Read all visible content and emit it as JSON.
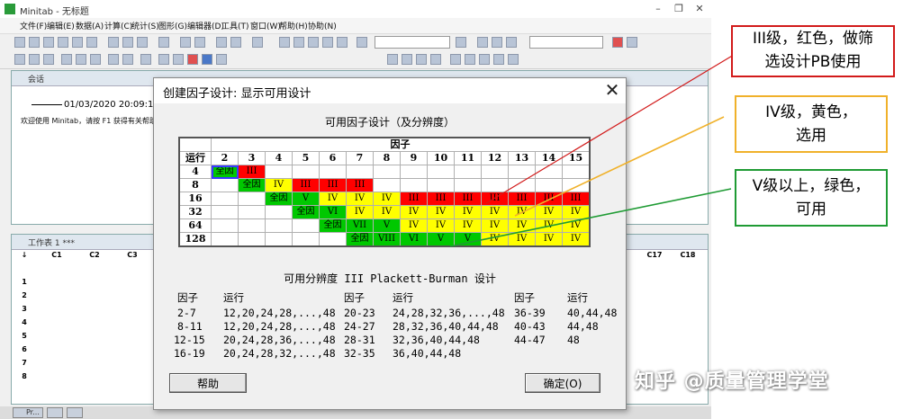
{
  "window": {
    "title": "Minitab - 无标题",
    "menu": [
      "文件(F)",
      "编辑(E)",
      "数据(A)",
      "计算(C)",
      "统计(S)",
      "图形(G)",
      "编辑器(D)",
      "工具(T)",
      "窗口(W)",
      "帮助(H)",
      "协助(N)"
    ]
  },
  "session": {
    "title": "会话",
    "date": "01/03/2020 20:09:19",
    "message": "欢迎使用 Minitab，请按 F1 获得有关帮助"
  },
  "worksheet": {
    "title": "工作表 1 ***",
    "columns": [
      "C1",
      "C2",
      "C3",
      "C17",
      "C18"
    ],
    "rows": [
      "1",
      "2",
      "3",
      "4",
      "5",
      "6",
      "7",
      "8"
    ],
    "corner": "↓"
  },
  "taskbar": {
    "tab1": "Pr..."
  },
  "dialog": {
    "title": "创建因子设计: 显示可用设计",
    "close_icon": "✕",
    "heading": "可用因子设计（及分辨度）",
    "factor_header": "因子",
    "run_header": "运行",
    "factors": [
      "2",
      "3",
      "4",
      "5",
      "6",
      "7",
      "8",
      "9",
      "10",
      "11",
      "12",
      "13",
      "14",
      "15"
    ],
    "runs": [
      {
        "run": "4",
        "cells": [
          {
            "t": "全因",
            "c": "grn"
          },
          {
            "t": "III",
            "c": "red"
          },
          {
            "t": "",
            "c": ""
          },
          {
            "t": "",
            "c": ""
          },
          {
            "t": "",
            "c": ""
          },
          {
            "t": "",
            "c": ""
          },
          {
            "t": "",
            "c": ""
          },
          {
            "t": "",
            "c": ""
          },
          {
            "t": "",
            "c": ""
          },
          {
            "t": "",
            "c": ""
          },
          {
            "t": "",
            "c": ""
          },
          {
            "t": "",
            "c": ""
          },
          {
            "t": "",
            "c": ""
          },
          {
            "t": "",
            "c": ""
          }
        ]
      },
      {
        "run": "8",
        "cells": [
          {
            "t": "",
            "c": ""
          },
          {
            "t": "全因",
            "c": "grn"
          },
          {
            "t": "IV",
            "c": "yel"
          },
          {
            "t": "III",
            "c": "red"
          },
          {
            "t": "III",
            "c": "red"
          },
          {
            "t": "III",
            "c": "red"
          },
          {
            "t": "",
            "c": ""
          },
          {
            "t": "",
            "c": ""
          },
          {
            "t": "",
            "c": ""
          },
          {
            "t": "",
            "c": ""
          },
          {
            "t": "",
            "c": ""
          },
          {
            "t": "",
            "c": ""
          },
          {
            "t": "",
            "c": ""
          },
          {
            "t": "",
            "c": ""
          }
        ]
      },
      {
        "run": "16",
        "cells": [
          {
            "t": "",
            "c": ""
          },
          {
            "t": "",
            "c": ""
          },
          {
            "t": "全因",
            "c": "grn"
          },
          {
            "t": "V",
            "c": "grn"
          },
          {
            "t": "IV",
            "c": "yel"
          },
          {
            "t": "IV",
            "c": "yel"
          },
          {
            "t": "IV",
            "c": "yel"
          },
          {
            "t": "III",
            "c": "red"
          },
          {
            "t": "III",
            "c": "red"
          },
          {
            "t": "III",
            "c": "red"
          },
          {
            "t": "III",
            "c": "red"
          },
          {
            "t": "III",
            "c": "red"
          },
          {
            "t": "III",
            "c": "red"
          },
          {
            "t": "III",
            "c": "red"
          }
        ]
      },
      {
        "run": "32",
        "cells": [
          {
            "t": "",
            "c": ""
          },
          {
            "t": "",
            "c": ""
          },
          {
            "t": "",
            "c": ""
          },
          {
            "t": "全因",
            "c": "grn"
          },
          {
            "t": "VI",
            "c": "grn"
          },
          {
            "t": "IV",
            "c": "yel"
          },
          {
            "t": "IV",
            "c": "yel"
          },
          {
            "t": "IV",
            "c": "yel"
          },
          {
            "t": "IV",
            "c": "yel"
          },
          {
            "t": "IV",
            "c": "yel"
          },
          {
            "t": "IV",
            "c": "yel"
          },
          {
            "t": "IV",
            "c": "yel"
          },
          {
            "t": "IV",
            "c": "yel"
          },
          {
            "t": "IV",
            "c": "yel"
          }
        ]
      },
      {
        "run": "64",
        "cells": [
          {
            "t": "",
            "c": ""
          },
          {
            "t": "",
            "c": ""
          },
          {
            "t": "",
            "c": ""
          },
          {
            "t": "",
            "c": ""
          },
          {
            "t": "全因",
            "c": "grn"
          },
          {
            "t": "VII",
            "c": "grn"
          },
          {
            "t": "V",
            "c": "grn"
          },
          {
            "t": "IV",
            "c": "yel"
          },
          {
            "t": "IV",
            "c": "yel"
          },
          {
            "t": "IV",
            "c": "yel"
          },
          {
            "t": "IV",
            "c": "yel"
          },
          {
            "t": "IV",
            "c": "yel"
          },
          {
            "t": "IV",
            "c": "yel"
          },
          {
            "t": "IV",
            "c": "yel"
          }
        ]
      },
      {
        "run": "128",
        "cells": [
          {
            "t": "",
            "c": ""
          },
          {
            "t": "",
            "c": ""
          },
          {
            "t": "",
            "c": ""
          },
          {
            "t": "",
            "c": ""
          },
          {
            "t": "",
            "c": ""
          },
          {
            "t": "全因",
            "c": "grn"
          },
          {
            "t": "VIII",
            "c": "grn"
          },
          {
            "t": "VI",
            "c": "grn"
          },
          {
            "t": "V",
            "c": "grn"
          },
          {
            "t": "V",
            "c": "grn"
          },
          {
            "t": "IV",
            "c": "yel"
          },
          {
            "t": "IV",
            "c": "yel"
          },
          {
            "t": "IV",
            "c": "yel"
          },
          {
            "t": "IV",
            "c": "yel"
          }
        ]
      }
    ],
    "result_title": "可用分辨度 III Plackett-Burman 设计",
    "pb_headers": {
      "factor": "因子",
      "run": "运行"
    },
    "pb_columns": [
      [
        [
          "2-7",
          "12,20,24,28,...,48"
        ],
        [
          "8-11",
          "12,20,24,28,...,48"
        ],
        [
          "12-15",
          "20,24,28,36,...,48"
        ],
        [
          "16-19",
          "20,24,28,32,...,48"
        ]
      ],
      [
        [
          "20-23",
          "24,28,32,36,...,48"
        ],
        [
          "24-27",
          "28,32,36,40,44,48"
        ],
        [
          "28-31",
          "32,36,40,44,48"
        ],
        [
          "32-35",
          "36,40,44,48"
        ]
      ],
      [
        [
          "36-39",
          "40,44,48"
        ],
        [
          "40-43",
          "44,48"
        ],
        [
          "44-47",
          "48"
        ]
      ]
    ],
    "help_button": "帮助",
    "ok_button": "确定(O)"
  },
  "annotations": {
    "red": {
      "line1": "III级，红色，做筛",
      "line2": "选设计PB使用",
      "color": "#d21a1a"
    },
    "yellow": {
      "line1": "IV级，黄色，",
      "line2": "选用",
      "color": "#f0b12a"
    },
    "green": {
      "line1": "V级以上，绿色，",
      "line2": "可用",
      "color": "#1f9b34"
    }
  },
  "watermark": "知乎 @质量管理学堂"
}
